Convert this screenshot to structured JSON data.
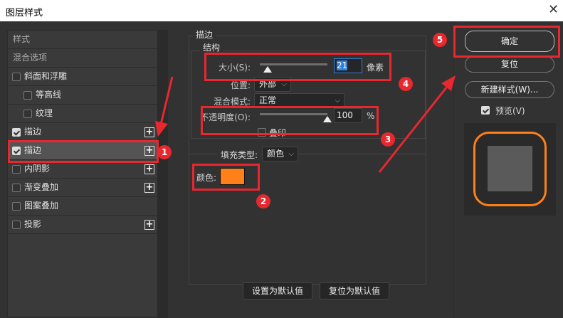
{
  "window": {
    "title": "图层样式",
    "close": "✕"
  },
  "sidebar": {
    "items": [
      {
        "label": "样式",
        "type": "header"
      },
      {
        "label": "混合选项",
        "type": "header"
      },
      {
        "label": "斜面和浮雕",
        "checked": false,
        "plus": false,
        "indent": false
      },
      {
        "label": "等高线",
        "checked": false,
        "plus": false,
        "indent": true
      },
      {
        "label": "纹理",
        "checked": false,
        "plus": false,
        "indent": true
      },
      {
        "label": "描边",
        "checked": true,
        "plus": true,
        "indent": false
      },
      {
        "label": "描边",
        "checked": true,
        "plus": true,
        "indent": false,
        "selected": true
      },
      {
        "label": "内阴影",
        "checked": false,
        "plus": true,
        "indent": false
      },
      {
        "label": "渐变叠加",
        "checked": false,
        "plus": true,
        "indent": false
      },
      {
        "label": "图案叠加",
        "checked": false,
        "plus": false,
        "indent": false
      },
      {
        "label": "投影",
        "checked": false,
        "plus": true,
        "indent": false
      }
    ],
    "plus_symbol": "+"
  },
  "stroke": {
    "group_title": "描边",
    "structure_title": "结构",
    "size_label": "大小(S):",
    "size_value": "21",
    "size_unit": "像素",
    "size_slider_fraction": 0.12,
    "position_label": "位置:",
    "position_value": "外部",
    "blend_label": "混合模式:",
    "blend_value": "正常",
    "opacity_label": "不透明度(O):",
    "opacity_value": "100",
    "opacity_unit": "%",
    "opacity_slider_fraction": 1.0,
    "overprint_label": "叠印",
    "overprint_checked": false,
    "fill_type_label": "填充类型:",
    "fill_type_value": "颜色",
    "color_label": "颜色:",
    "color": "#ff8019",
    "set_default": "设置为默认值",
    "reset_default": "复位为默认值"
  },
  "actions": {
    "ok": "确定",
    "reset": "复位",
    "new_style": "新建样式(W)...",
    "preview_label": "预览(V)",
    "preview_checked": true
  },
  "annotations": [
    "1",
    "2",
    "3",
    "4",
    "5"
  ],
  "colors": {
    "annotation": "#e8272f",
    "stroke": "#ff8019"
  }
}
